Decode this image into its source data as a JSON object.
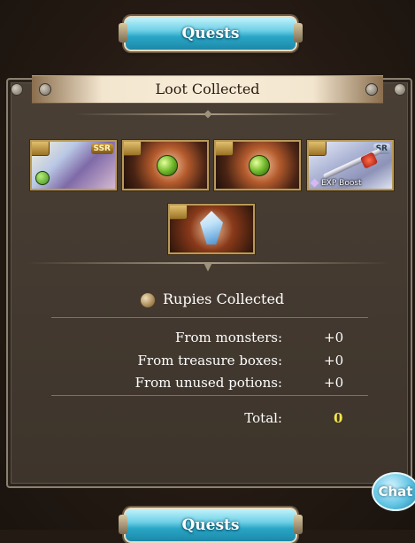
{
  "header": {
    "quests_label": "Quests"
  },
  "panel": {
    "title": "Loot Collected"
  },
  "loot": {
    "items": [
      {
        "kind": "character",
        "badge": "SSR"
      },
      {
        "kind": "element-orb"
      },
      {
        "kind": "element-orb"
      },
      {
        "kind": "weapon",
        "badge": "SR",
        "label": "EXP Boost"
      },
      {
        "kind": "crystal"
      }
    ]
  },
  "rupies": {
    "title": "Rupies Collected",
    "rows": [
      {
        "label": "From monsters:",
        "value": "+0"
      },
      {
        "label": "From treasure boxes:",
        "value": "+0"
      },
      {
        "label": "From unused potions:",
        "value": "+0"
      }
    ],
    "total_label": "Total:",
    "total_value": "0"
  },
  "footer": {
    "quests_label": "Quests",
    "chat_label": "Chat"
  },
  "colors": {
    "accent_blue": "#2aa6c6",
    "total_yellow": "#f6e64a",
    "panel_bg": "#3d342b"
  }
}
